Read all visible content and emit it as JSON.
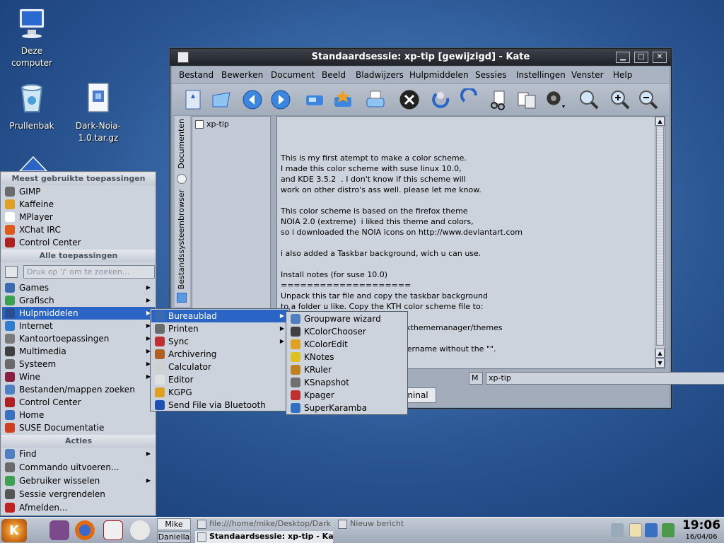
{
  "desktop": {
    "icons": [
      {
        "label": "Deze computer",
        "icon": "computer-icon"
      },
      {
        "label": "Prullenbak",
        "icon": "trash-icon"
      },
      {
        "label": "Dark-Noia-1.0.tar.gz",
        "icon": "archive-icon"
      }
    ]
  },
  "kate": {
    "title": "Standaardsessie: xp-tip [gewijzigd] - Kate",
    "menu": [
      "Bestand",
      "Bewerken",
      "Document",
      "Beeld",
      "Bladwijzers",
      "Hulpmiddelen",
      "Sessies",
      "Instellingen",
      "Venster",
      "Help"
    ],
    "side_tabs": [
      "Documenten",
      "Bestandssysteembrowser"
    ],
    "doc_item": "xp-tip",
    "editor_lines": [
      "",
      "This is my first atempt to make a color scheme.",
      "I made this color scheme with suse linux 10.0,",
      "and KDE 3.5.2  . I don't know if this scheme will",
      "work on other distro's ass well. please let me know.",
      "",
      "This color scheme is based on the firefox theme",
      "NOIA 2.0 (extreme)  i liked this theme and colors,",
      "so i downloaded the NOIA icons on http://www.deviantart.com",
      "",
      "i also added a Taskbar background, wich u can use.",
      "",
      "Install notes (for suse 10.0)",
      "====================",
      "Unpack this tar file and copy the taskbar background",
      "to a folder u like. Copy the KTH color scheme file to:",
      "",
      "                                         /apps/kthememanager/themes",
      "",
      "                                        own username without the \"\"."
    ],
    "status_mode": "M",
    "status_file": "xp-tip",
    "terminal_tab": "minal"
  },
  "kmenu": {
    "most_used_header": "Meest gebruikte toepassingen",
    "most_used": [
      {
        "label": "GIMP",
        "icon": "gimp-icon",
        "color": "#6b6b6b"
      },
      {
        "label": "Kaffeine",
        "icon": "kaffeine-icon",
        "color": "#e0a020"
      },
      {
        "label": "MPlayer",
        "icon": "mplayer-icon",
        "color": "#ffffff"
      },
      {
        "label": "XChat IRC",
        "icon": "xchat-icon",
        "color": "#e05a1a"
      },
      {
        "label": "Control Center",
        "icon": "control-center-icon",
        "color": "#b02020"
      }
    ],
    "all_apps_header": "Alle toepassingen",
    "search_placeholder": "Druk op '/' om te zoeken...",
    "categories": [
      {
        "label": "Games",
        "icon": "games-icon",
        "color": "#3a6ab0",
        "submenu": true
      },
      {
        "label": "Grafisch",
        "icon": "graphics-icon",
        "color": "#3ba050",
        "submenu": true
      },
      {
        "label": "Hulpmiddelen",
        "icon": "utilities-icon",
        "color": "#2a4f90",
        "submenu": true,
        "selected": true
      },
      {
        "label": "Internet",
        "icon": "internet-icon",
        "color": "#2e7fd0",
        "submenu": true
      },
      {
        "label": "Kantoortoepassingen",
        "icon": "office-icon",
        "color": "#7a7a7a",
        "submenu": true
      },
      {
        "label": "Multimedia",
        "icon": "multimedia-icon",
        "color": "#404040",
        "submenu": true
      },
      {
        "label": "Systeem",
        "icon": "system-icon",
        "color": "#6a6a6a",
        "submenu": true
      },
      {
        "label": "Wine",
        "icon": "wine-icon",
        "color": "#8a2040",
        "submenu": true
      },
      {
        "label": "Bestanden/mappen zoeken",
        "icon": "find-files-icon",
        "color": "#5080c0",
        "submenu": false
      },
      {
        "label": "Control Center",
        "icon": "control-center-icon",
        "color": "#b02020",
        "submenu": false
      },
      {
        "label": "Home",
        "icon": "home-icon",
        "color": "#3a70c0",
        "submenu": false
      },
      {
        "label": "SUSE Documentatie",
        "icon": "suse-doc-icon",
        "color": "#d04020",
        "submenu": false
      }
    ],
    "actions_header": "Acties",
    "actions": [
      {
        "label": "Find",
        "icon": "find-icon",
        "color": "#5080c0",
        "submenu": true
      },
      {
        "label": "Commando uitvoeren...",
        "icon": "run-command-icon",
        "color": "#6a6a6a",
        "submenu": false
      },
      {
        "label": "Gebruiker wisselen",
        "icon": "switch-user-icon",
        "color": "#3ba050",
        "submenu": true
      },
      {
        "label": "Sessie vergrendelen",
        "icon": "lock-session-icon",
        "color": "#555555",
        "submenu": false
      },
      {
        "label": "Afmelden...",
        "icon": "logout-icon",
        "color": "#c02020",
        "submenu": false
      }
    ]
  },
  "submenu_utilities": [
    {
      "label": "Bureaublad",
      "icon": "desktop-icon",
      "color": "#3a6ab0",
      "submenu": true,
      "selected": true
    },
    {
      "label": "Printen",
      "icon": "printer-icon",
      "color": "#6a6a6a",
      "submenu": true
    },
    {
      "label": "Sync",
      "icon": "sync-icon",
      "color": "#c03030",
      "submenu": true
    },
    {
      "label": "Archivering",
      "icon": "archive-icon",
      "color": "#b06020",
      "submenu": false
    },
    {
      "label": "Calculator",
      "icon": "calculator-icon",
      "color": "#d0d0d0",
      "submenu": false
    },
    {
      "label": "Editor",
      "icon": "editor-icon",
      "color": "#e0e0e0",
      "submenu": false
    },
    {
      "label": "KGPG",
      "icon": "kgpg-icon",
      "color": "#e0a020",
      "submenu": false
    },
    {
      "label": "Send File via Bluetooth",
      "icon": "bluetooth-icon",
      "color": "#2050b0",
      "submenu": false
    }
  ],
  "submenu_desktop": [
    {
      "label": "Groupware wizard",
      "icon": "groupware-icon",
      "color": "#5080c0"
    },
    {
      "label": "KColorChooser",
      "icon": "color-picker-icon",
      "color": "#404040"
    },
    {
      "label": "KColorEdit",
      "icon": "color-edit-icon",
      "color": "#e0a020"
    },
    {
      "label": "KNotes",
      "icon": "notes-icon",
      "color": "#e0c020"
    },
    {
      "label": "KRuler",
      "icon": "ruler-icon",
      "color": "#c08020"
    },
    {
      "label": "KSnapshot",
      "icon": "snapshot-icon",
      "color": "#707070"
    },
    {
      "label": "Kpager",
      "icon": "pager-icon",
      "color": "#c03030"
    },
    {
      "label": "SuperKaramba",
      "icon": "superkaramba-icon",
      "color": "#3070c0"
    }
  ],
  "taskbar": {
    "desktops": [
      "Mike",
      "Daniella"
    ],
    "tasks": [
      {
        "label": "file:///home/mike/Desktop/Dark",
        "icon": "konqueror-icon"
      },
      {
        "label": "Nieuw bericht",
        "icon": "mail-compose-icon"
      },
      {
        "label": "Standaardsessie: xp-tip - Kat",
        "icon": "kate-icon"
      }
    ],
    "time": "19:06",
    "date": "16/04/06"
  }
}
